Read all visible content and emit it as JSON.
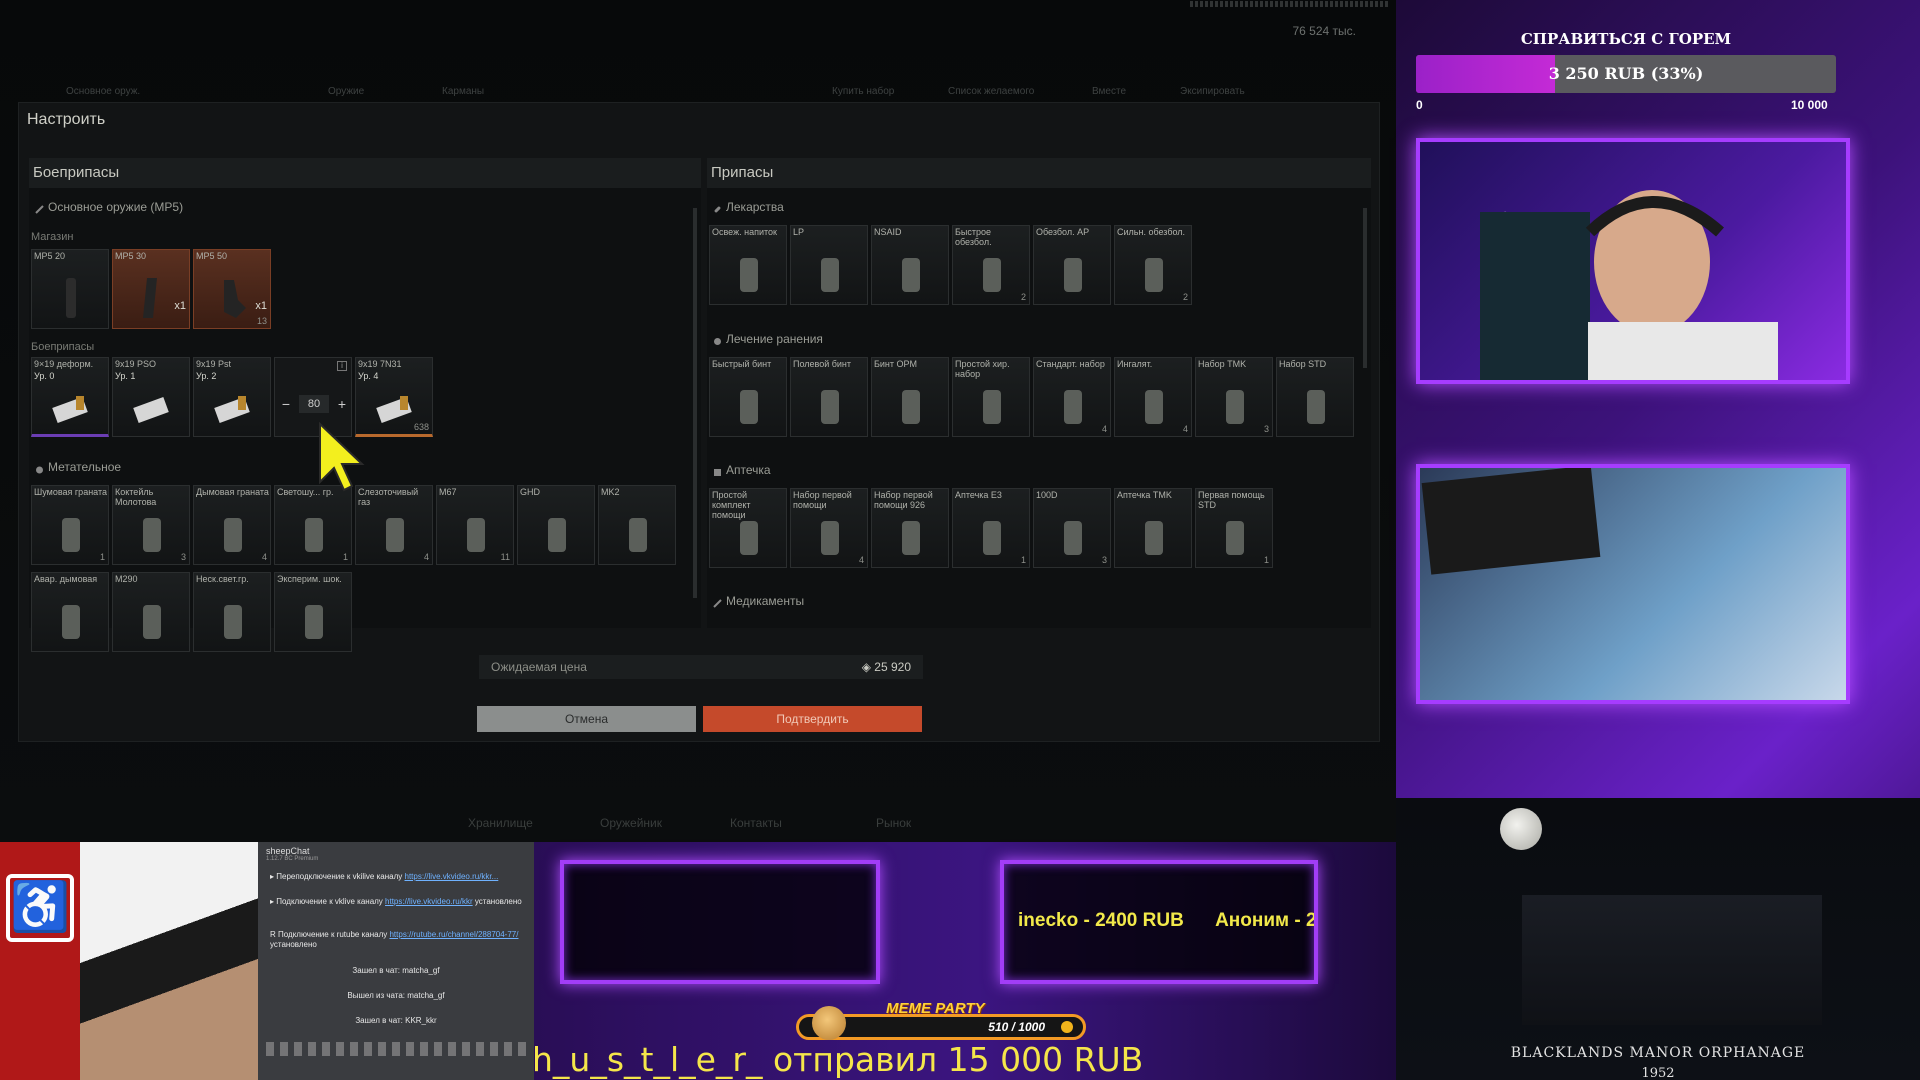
{
  "game": {
    "top_info": "76 524 тыс.",
    "bg_tabs": [
      "Основное оруж.",
      "Оружие",
      "Карманы",
      "Купить набор",
      "Список желаемого",
      "Вместе",
      "Эксипировать"
    ],
    "modal_title": "Настроить",
    "ammo": {
      "title": "Боеприпасы",
      "weapon_section": "Основное оружие (MP5)",
      "magazines_label": "Магазин",
      "magazines": [
        {
          "name": "MP5 20",
          "qty": "",
          "count": ""
        },
        {
          "name": "MP5 30",
          "qty": "x1",
          "count": ""
        },
        {
          "name": "MP5 50",
          "qty": "x1",
          "count": "13"
        }
      ],
      "rounds_label": "Боеприпасы",
      "rounds": [
        {
          "name": "9×19 деформ.",
          "level": "Ур. 0",
          "count": ""
        },
        {
          "name": "9х19 PSO",
          "level": "Ур. 1",
          "count": ""
        },
        {
          "name": "9х19 Pst",
          "level": "Ур. 2",
          "count": ""
        },
        {
          "name": "9х19 7N31",
          "level": "Ур. 4",
          "count": "638"
        }
      ],
      "stepper": {
        "minus": "−",
        "value": "80",
        "plus": "+",
        "info": "i"
      },
      "throwables_label": "Метательное",
      "throwables": [
        {
          "name": "Шумовая граната",
          "count": "1"
        },
        {
          "name": "Коктейль Молотова",
          "count": "3"
        },
        {
          "name": "Дымовая граната",
          "count": "4"
        },
        {
          "name": "Светошу... гр.",
          "count": "1"
        },
        {
          "name": "Слезоточивый газ",
          "count": "4"
        },
        {
          "name": "M67",
          "count": "11"
        },
        {
          "name": "GHD",
          "count": ""
        },
        {
          "name": "MK2",
          "count": ""
        }
      ],
      "throwables_row2": [
        {
          "name": "Авар. дымовая"
        },
        {
          "name": "M290"
        },
        {
          "name": "Неск.свет.гр."
        },
        {
          "name": "Эксперим. шок."
        }
      ]
    },
    "supplies": {
      "title": "Припасы",
      "meds_label": "Лекарства",
      "meds": [
        {
          "name": "Освеж. напиток",
          "count": ""
        },
        {
          "name": "LP",
          "count": ""
        },
        {
          "name": "NSAID",
          "count": ""
        },
        {
          "name": "Быстрое обезбол.",
          "count": "2"
        },
        {
          "name": "Обезбол. AP",
          "count": ""
        },
        {
          "name": "Сильн. обезбол.",
          "count": "2"
        }
      ],
      "wounds_label": "Лечение ранения",
      "wounds": [
        {
          "name": "Быстрый бинт",
          "count": ""
        },
        {
          "name": "Полевой бинт",
          "count": ""
        },
        {
          "name": "Бинт OPM",
          "count": ""
        },
        {
          "name": "Простой хир. набор",
          "count": ""
        },
        {
          "name": "Стандарт. набор",
          "count": "4"
        },
        {
          "name": "Ингалят.",
          "count": "4"
        },
        {
          "name": "Набор TMK",
          "count": "3"
        },
        {
          "name": "Набор STD",
          "count": ""
        }
      ],
      "kits_label": "Аптечка",
      "kits": [
        {
          "name": "Простой комплект помощи",
          "count": ""
        },
        {
          "name": "Набор первой помощи",
          "count": "4"
        },
        {
          "name": "Набор первой помощи 926",
          "count": ""
        },
        {
          "name": "Аптечка E3",
          "count": "1"
        },
        {
          "name": "100D",
          "count": "3"
        },
        {
          "name": "Аптечка TMK",
          "count": ""
        },
        {
          "name": "Первая помощь STD",
          "count": "1"
        }
      ],
      "medicine_label": "Медикаменты"
    },
    "expected_price_label": "Ожидаемая цена",
    "expected_price_value": "25 920",
    "cancel_label": "Отмена",
    "confirm_label": "Подтвердить",
    "bottom_tabs": [
      "Хранилище",
      "Оружейник",
      "Контакты",
      "Рынок"
    ]
  },
  "stream": {
    "goal_title": "СПРАВИТЬСЯ С ГОРЕМ",
    "goal_text": "3 250 RUB (33%)",
    "goal_progress": 0.33,
    "goal_min": "0",
    "goal_max": "10 000",
    "chat": {
      "header": "sheepChat",
      "subheader": "1.12.7 BC Premium",
      "lines": [
        {
          "text": "Переподключение к vkilive каналу ",
          "link": "https://live.vkvideo.ru/kkr..."
        },
        {
          "text": "Подключение к vklive каналу ",
          "link": "https://live.vkvideo.ru/kkr",
          "tail": " установлено"
        },
        {
          "text": "Подключение к rutube каналу ",
          "link": "https://rutube.ru/channel/288704-77/",
          "tail": " установлено"
        }
      ],
      "system": [
        "Зашел в чат: matcha_gf",
        "Вышел из чата: matcha_gf",
        "Зашел в чат: KKR_kkr"
      ]
    },
    "ticker": [
      "inecko - 2400 RUB",
      "Аноним - 2"
    ],
    "meme_title": "MEME PARTY",
    "meme_progress": "510 / 1000",
    "alert": "h_u_s_t_l_e_r_ отправил 15 000 RUB",
    "manor_title": "BLACKLANDS MANOR ORPHANAGE",
    "manor_year": "1952"
  },
  "colors": {
    "accent_orange": "#c54a2b",
    "stream_purple": "#a63cff",
    "ticker_yellow": "#f2e94a"
  }
}
